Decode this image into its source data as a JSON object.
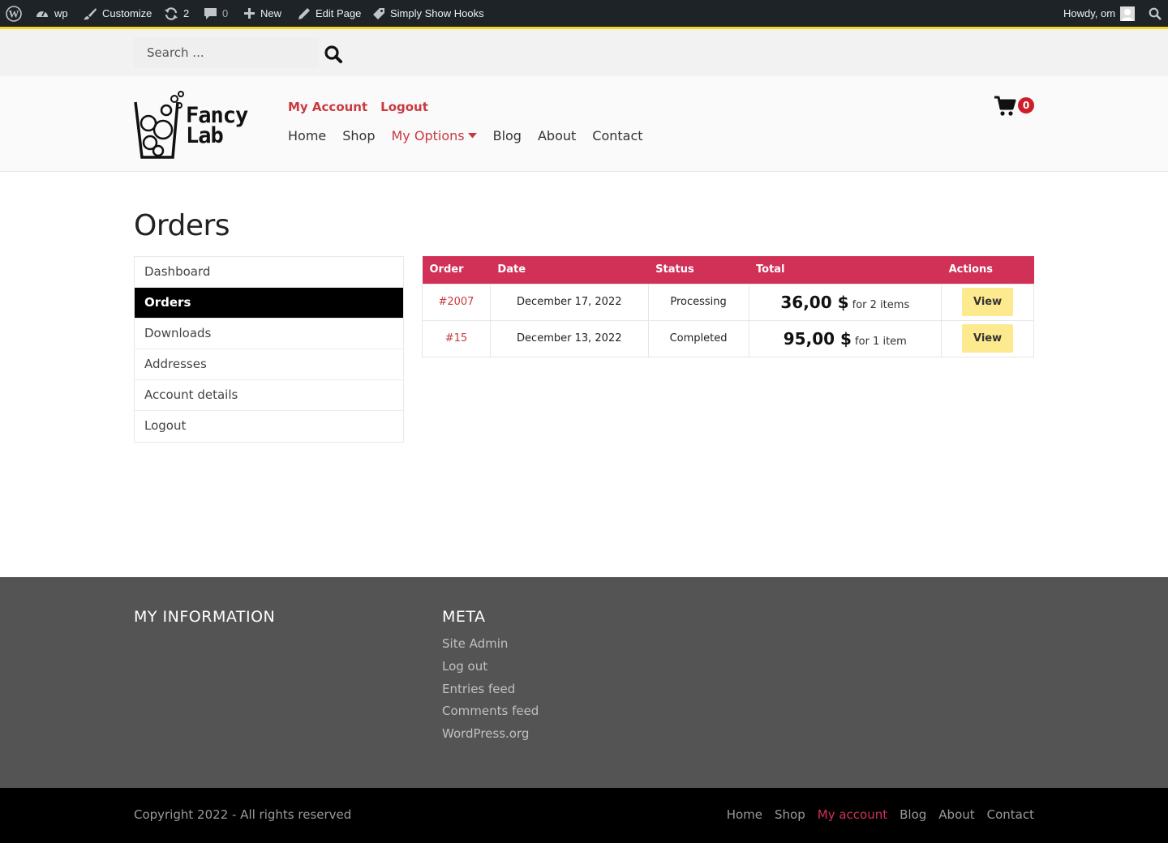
{
  "adminbar": {
    "site_name": "wp",
    "customize": "Customize",
    "updates_count": "2",
    "comments_count": "0",
    "new": "New",
    "edit_page": "Edit Page",
    "plugin": "Simply Show Hooks",
    "howdy": "Howdy, om"
  },
  "search": {
    "placeholder": "Search ..."
  },
  "header": {
    "logo_line1": "Fancy",
    "logo_line2": "Lab",
    "top_links": [
      "My Account",
      "Logout"
    ],
    "nav": [
      "Home",
      "Shop",
      "My Options",
      "Blog",
      "About",
      "Contact"
    ],
    "active_nav": "My Options",
    "cart_count": "0"
  },
  "page": {
    "title": "Orders"
  },
  "account_nav": {
    "items": [
      "Dashboard",
      "Orders",
      "Downloads",
      "Addresses",
      "Account details",
      "Logout"
    ],
    "current": "Orders"
  },
  "orders": {
    "headers": [
      "Order",
      "Date",
      "Status",
      "Total",
      "Actions"
    ],
    "rows": [
      {
        "number": "#2007",
        "date": "December 17, 2022",
        "status": "Processing",
        "amount": "36,00 $",
        "items": "for 2 items",
        "action": "View"
      },
      {
        "number": "#15",
        "date": "December 13, 2022",
        "status": "Completed",
        "amount": "95,00 $",
        "items": "for 1 item",
        "action": "View"
      }
    ]
  },
  "footer": {
    "col1_title": "MY INFORMATION",
    "col2_title": "META",
    "meta_links": [
      "Site Admin",
      "Log out",
      "Entries feed",
      "Comments feed",
      "WordPress.org"
    ],
    "copyright": "Copyright 2022 - All rights reserved",
    "nav": [
      "Home",
      "Shop",
      "My account",
      "Blog",
      "About",
      "Contact"
    ],
    "active_nav": "My account"
  },
  "colors": {
    "accent": "#d23157",
    "link_red": "#c9393f",
    "view_button": "#fde98e",
    "adminbar": "#1d2327",
    "footer": "#545454"
  }
}
